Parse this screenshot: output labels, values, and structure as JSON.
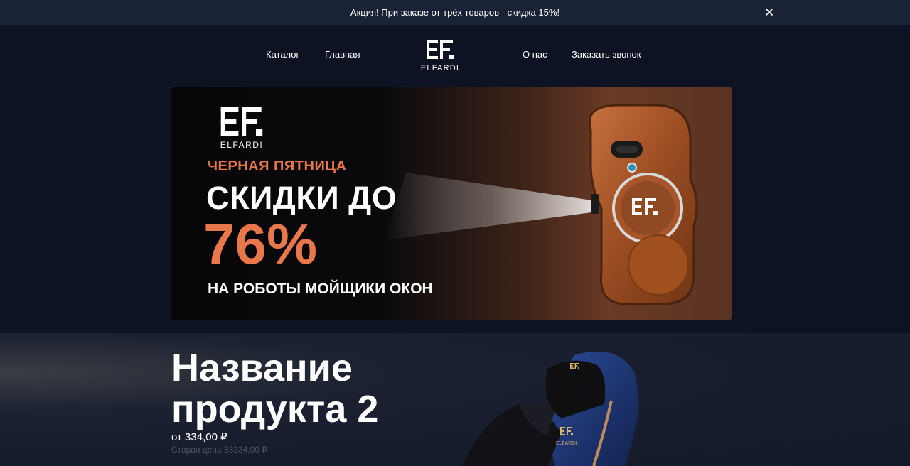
{
  "promo": {
    "text": "Акция! При заказе от трёх товаров - скидка 15%!",
    "close_icon": "close-icon"
  },
  "nav": {
    "catalog": "Каталог",
    "home": "Главная",
    "about": "О нас",
    "callback": "Заказать звонок"
  },
  "logo": {
    "mark": "EF.",
    "text": "ELFARDI"
  },
  "banner": {
    "logo_text": "ELFARDI",
    "kicker": "ЧЕРНАЯ ПЯТНИЦА",
    "headline": "СКИДКИ ДО",
    "percent": "76%",
    "subline": "НА РОБОТЫ МОЙЩИКИ ОКОН",
    "accent_color": "#e8774b"
  },
  "product": {
    "title_line1": "Название",
    "title_line2": "продукта 2",
    "price": "от 334,00 ₽",
    "old_price": "Старая цена 33334,00 ₽",
    "chair_logo_text": "ELFARDI"
  },
  "colors": {
    "page_bg": "#0d1322",
    "promo_bg": "#1a2236",
    "accent": "#e8774b"
  }
}
